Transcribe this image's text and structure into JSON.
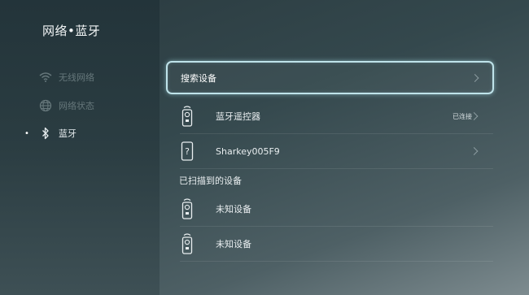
{
  "page": {
    "title": "网络•蓝牙"
  },
  "sidebar": {
    "items": [
      {
        "label": "无线网络",
        "icon": "wifi-icon",
        "active": false
      },
      {
        "label": "网络状态",
        "icon": "globe-icon",
        "active": false
      },
      {
        "label": "蓝牙",
        "icon": "bluetooth-icon",
        "active": true
      }
    ]
  },
  "main": {
    "search": {
      "label": "搜索设备"
    },
    "paired_devices": [
      {
        "name": "蓝牙遥控器",
        "status": "已连接",
        "icon": "remote-control-icon"
      },
      {
        "name": "Sharkey005F9",
        "status": "",
        "icon": "unknown-device-icon"
      }
    ],
    "scanned_section_label": "已扫描到的设备",
    "scanned_devices": [
      {
        "name": "未知设备",
        "icon": "remote-control-icon"
      },
      {
        "name": "未知设备",
        "icon": "remote-control-icon"
      }
    ]
  },
  "colors": {
    "focus_border": "#bfe3ea",
    "inactive_text": "#66777b",
    "active_text": "#e6ecee"
  }
}
